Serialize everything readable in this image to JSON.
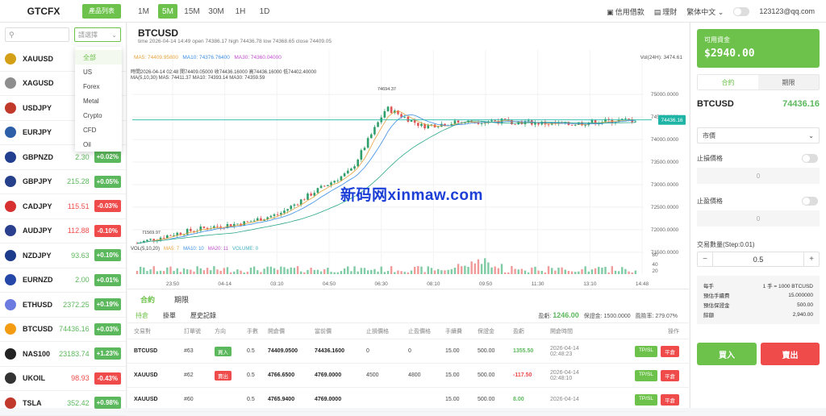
{
  "header": {
    "brand": "GTCFX",
    "products_button": "產品列表",
    "timeframes": [
      "1M",
      "5M",
      "15M",
      "30M",
      "1H",
      "1D"
    ],
    "active_timeframe": "5M",
    "credit_loan": "信用借款",
    "wealth": "理財",
    "language": "繁体中文",
    "user_email": "123123@qq.com"
  },
  "sidebar": {
    "search_placeholder": "",
    "select_placeholder": "請選擇",
    "dropdown_options": [
      "全部",
      "US",
      "Forex",
      "Metal",
      "Crypto",
      "CFD",
      "Oil"
    ],
    "selected_option": "全部",
    "symbols": [
      {
        "name": "XAUUSD",
        "price": "4769",
        "change": "",
        "dir": "up"
      },
      {
        "name": "XAGUSD",
        "price": "76.",
        "change": "",
        "dir": "up"
      },
      {
        "name": "USDJPY",
        "price": "159.",
        "change": "",
        "dir": "down"
      },
      {
        "name": "EURJPY",
        "price": "187.",
        "change": "",
        "dir": "up"
      },
      {
        "name": "GBPNZD",
        "price": "2.30",
        "change": "+0.02%",
        "dir": "up"
      },
      {
        "name": "GBPJPY",
        "price": "215.28",
        "change": "+0.05%",
        "dir": "up"
      },
      {
        "name": "CADJPY",
        "price": "115.51",
        "change": "-0.03%",
        "dir": "down"
      },
      {
        "name": "AUDJPY",
        "price": "112.88",
        "change": "-0.10%",
        "dir": "down"
      },
      {
        "name": "NZDJPY",
        "price": "93.63",
        "change": "+0.10%",
        "dir": "up"
      },
      {
        "name": "EURNZD",
        "price": "2.00",
        "change": "+0.01%",
        "dir": "up"
      },
      {
        "name": "ETHUSD",
        "price": "2372.25",
        "change": "+0.19%",
        "dir": "up"
      },
      {
        "name": "BTCUSD",
        "price": "74436.16",
        "change": "+0.03%",
        "dir": "up"
      },
      {
        "name": "NAS100",
        "price": "23183.74",
        "change": "+1.23%",
        "dir": "up"
      },
      {
        "name": "UKOIL",
        "price": "98.93",
        "change": "-0.43%",
        "dir": "down"
      },
      {
        "name": "TSLA",
        "price": "352.42",
        "change": "+0.98%",
        "dir": "up"
      }
    ],
    "colors": {
      "up": "#5cb85c",
      "down": "#ef4b4b"
    }
  },
  "chart": {
    "symbol": "BTCUSD",
    "info": "time 2026-04-14 14:49   open 74386.17   high 74436.78   low 74368.65   close 74409.05",
    "ma5": "MA5: 74409.95800",
    "ma10": "MA10: 74376.76400",
    "ma30": "MA30: 74360.04000",
    "vol24": "Vol(24H): 3474.61",
    "ohlc_line": "時間2026-04-14 02:48   開74409.05000   收74436.16000   高74436.16000   低74402.40000",
    "ma_line2": "MA(5,10,30)   MA5: 74411.37   MA10: 74393.14   MA30: 74359.59",
    "vol_line": {
      "label": "VOL(5,10,20)",
      "ma5": "MA5: 7",
      "ma10": "MA10: 10",
      "ma20": "MA20: 11",
      "volume": "VOLUME: 0"
    },
    "current_price_label": "74436.16",
    "high_marker": "74694.37",
    "low_marker": "71569.97",
    "watermark": "新码网xinmaw.com"
  },
  "chart_data": {
    "type": "line",
    "x": [
      "23:50",
      "04-14",
      "03:10",
      "04:50",
      "06:30",
      "08:10",
      "09:50",
      "11:30",
      "13:10",
      "14:48"
    ],
    "ylim": [
      71300,
      75200
    ],
    "yticks": [
      75000,
      74500,
      74000,
      73500,
      73000,
      72500,
      72000,
      71500
    ],
    "volume_ticks": [
      80,
      40,
      20
    ],
    "series": [
      {
        "values": [
          71700,
          71900,
          72050,
          72150,
          72350,
          72850,
          73300,
          74700,
          74300,
          74380,
          74420,
          74380,
          74330,
          74400,
          74436
        ]
      }
    ]
  },
  "orders": {
    "tabs": [
      "合約",
      "期限"
    ],
    "sub_tabs": [
      "持倉",
      "掛單",
      "歷史記錄"
    ],
    "summary": {
      "pnl_label": "盈虧:",
      "pnl": "1246.00",
      "margin": "保證金: 1500.0000",
      "risk": "風險率: 279.07%"
    },
    "columns": [
      "交易對",
      "訂單號",
      "方向",
      "手數",
      "開倉價",
      "當前價",
      "止損價格",
      "止盈價格",
      "手續費",
      "保證金",
      "盈虧",
      "開倉時間",
      "操作"
    ],
    "rows": [
      {
        "pair": "BTCUSD",
        "id": "#63",
        "dir": "買入",
        "side": "buy",
        "lots": "0.5",
        "open": "74409.0500",
        "current": "74436.1600",
        "sl": "0",
        "tp": "0",
        "fee": "15.00",
        "margin": "500.00",
        "pnl": "1355.50",
        "pnl_dir": "up",
        "date": "2026-04-14",
        "time": "02:48:23"
      },
      {
        "pair": "XAUUSD",
        "id": "#62",
        "dir": "賣出",
        "side": "sell",
        "lots": "0.5",
        "open": "4766.6500",
        "current": "4769.0000",
        "sl": "4500",
        "tp": "4800",
        "fee": "15.00",
        "margin": "500.00",
        "pnl": "-117.50",
        "pnl_dir": "down",
        "date": "2026-04-14",
        "time": "02:48:10"
      },
      {
        "pair": "XAUUSD",
        "id": "#60",
        "dir": "",
        "side": "buy",
        "lots": "0.5",
        "open": "4765.9400",
        "current": "4769.0000",
        "sl": "",
        "tp": "",
        "fee": "15.00",
        "margin": "500.00",
        "pnl": "8.00",
        "pnl_dir": "up",
        "date": "2026-04-14",
        "time": ""
      }
    ],
    "actions": {
      "tpsl": "TP/SL",
      "close": "平倉"
    }
  },
  "trade_panel": {
    "available_label": "可用資金",
    "available_value": "$2940.00",
    "tabs": [
      "合約",
      "期限"
    ],
    "symbol": "BTCUSD",
    "price": "74436.16",
    "order_type": "市價",
    "stop_loss_label": "止損價格",
    "stop_loss_value": "0",
    "take_profit_label": "止盈價格",
    "take_profit_value": "0",
    "qty_label": "交易數量(Step:0.01)",
    "qty_value": "0.5",
    "fees": [
      {
        "label": "每手",
        "value": "1 手 = 1000 BTCUSD"
      },
      {
        "label": "預估手續費",
        "value": "15.000000"
      },
      {
        "label": "預估保證金",
        "value": "500.00"
      },
      {
        "label": "餘額",
        "value": "2,940.00"
      }
    ],
    "buy": "買入",
    "sell": "賣出"
  }
}
